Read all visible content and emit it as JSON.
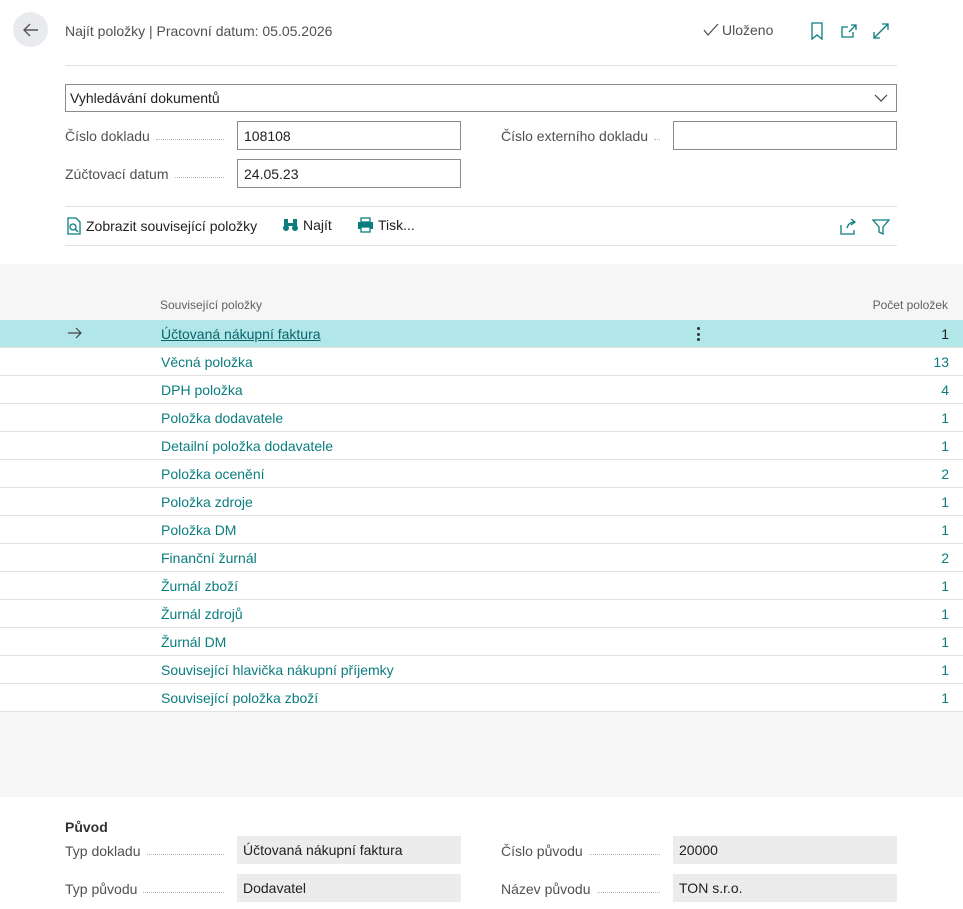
{
  "header": {
    "title": "Najít položky | Pracovní datum: 05.05.2026",
    "saved_label": "Uloženo"
  },
  "dropdown": {
    "value": "Vyhledávání dokumentů"
  },
  "fields": {
    "doc_no_label": "Číslo dokladu",
    "doc_no_value": "108108",
    "ext_doc_label": "Číslo externího dokladu",
    "ext_doc_value": "",
    "posting_date_label": "Zúčtovací datum",
    "posting_date_value": "24.05.23"
  },
  "actions": {
    "show_related": "Zobrazit související položky",
    "find": "Najít",
    "print": "Tisk..."
  },
  "list": {
    "col_name": "Související položky",
    "col_count": "Počet položek",
    "rows": [
      {
        "name": "Účtovaná nákupní faktura",
        "count": "1"
      },
      {
        "name": "Věcná položka",
        "count": "13"
      },
      {
        "name": "DPH položka",
        "count": "4"
      },
      {
        "name": "Položka dodavatele",
        "count": "1"
      },
      {
        "name": "Detailní položka dodavatele",
        "count": "1"
      },
      {
        "name": "Položka ocenění",
        "count": "2"
      },
      {
        "name": "Položka zdroje",
        "count": "1"
      },
      {
        "name": "Položka DM",
        "count": "1"
      },
      {
        "name": "Finanční žurnál",
        "count": "2"
      },
      {
        "name": "Žurnál zboží",
        "count": "1"
      },
      {
        "name": "Žurnál zdrojů",
        "count": "1"
      },
      {
        "name": "Žurnál DM",
        "count": "1"
      },
      {
        "name": "Související hlavička nákupní příjemky",
        "count": "1"
      },
      {
        "name": "Související položka zboží",
        "count": "1"
      }
    ]
  },
  "origin": {
    "title": "Původ",
    "doc_type_label": "Typ dokladu",
    "doc_type_value": "Účtovaná nákupní faktura",
    "origin_no_label": "Číslo původu",
    "origin_no_value": "20000",
    "origin_type_label": "Typ původu",
    "origin_type_value": "Dodavatel",
    "origin_name_label": "Název původu",
    "origin_name_value": "TON s.r.o."
  },
  "colors": {
    "accent": "#0b7d7f",
    "selected_row": "#b2e7ea"
  }
}
